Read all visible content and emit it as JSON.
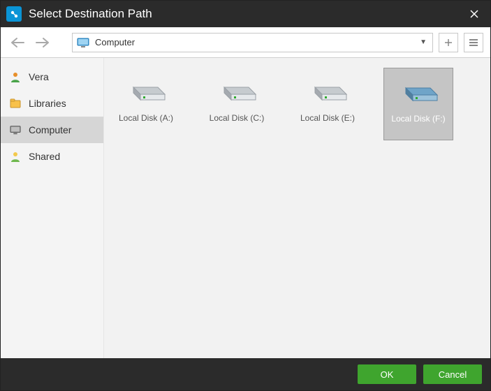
{
  "title": "Select Destination Path",
  "location": "Computer",
  "sidebar": {
    "items": [
      {
        "label": "Vera"
      },
      {
        "label": "Libraries"
      },
      {
        "label": "Computer"
      },
      {
        "label": "Shared"
      }
    ],
    "selected_index": 2
  },
  "drives": [
    {
      "label": "Local Disk (A:)",
      "selected": false,
      "color": "gray"
    },
    {
      "label": "Local Disk (C:)",
      "selected": false,
      "color": "gray"
    },
    {
      "label": "Local Disk (E:)",
      "selected": false,
      "color": "gray"
    },
    {
      "label": "Local Disk (F:)",
      "selected": true,
      "color": "blue"
    }
  ],
  "buttons": {
    "ok": "OK",
    "cancel": "Cancel"
  }
}
